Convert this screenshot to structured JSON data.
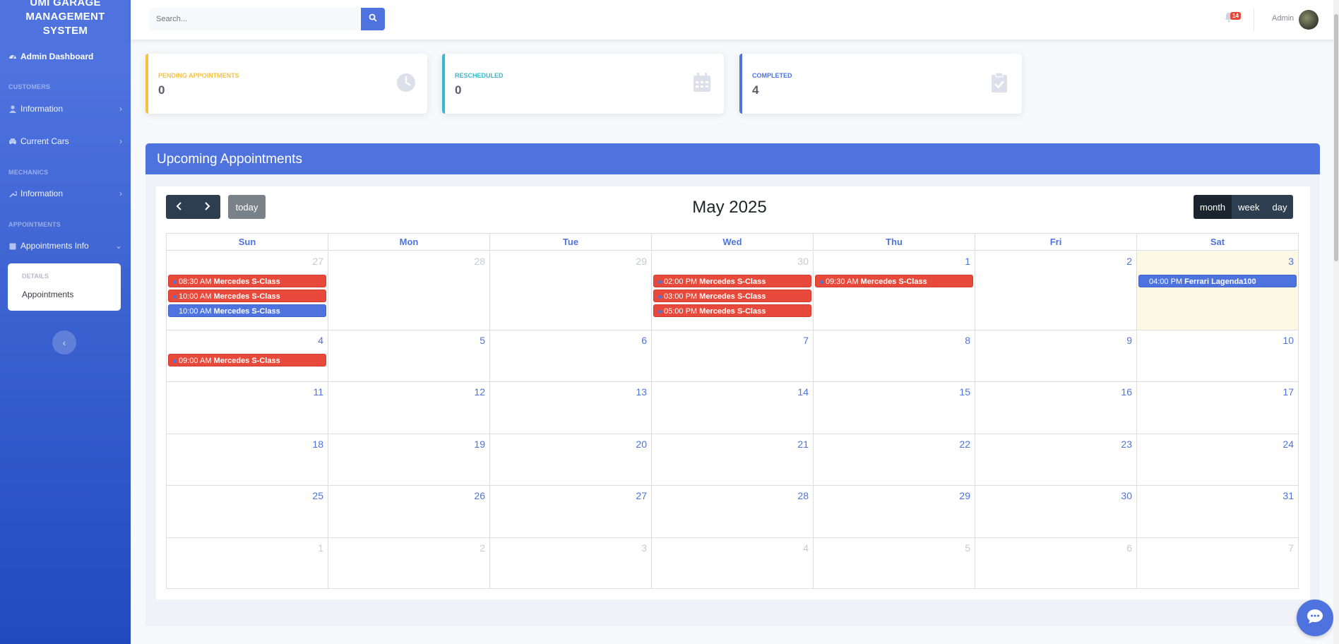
{
  "sidebar": {
    "brand": [
      "UMI GARAGE",
      "MANAGEMENT",
      "SYSTEM"
    ],
    "dashboard": "Admin Dashboard",
    "customers_heading": "CUSTOMERS",
    "customers_information": "Information",
    "current_cars": "Current Cars",
    "mechanics_heading": "MECHANICS",
    "mechanics_information": "Information",
    "appointments_heading": "APPOINTMENTS",
    "appointments_info": "Appointments Info",
    "submenu_heading": "DETAILS",
    "submenu_item": "Appointments"
  },
  "topbar": {
    "search_placeholder": "Search...",
    "alerts_count": "14",
    "user_name": "Admin"
  },
  "stats": [
    {
      "label": "PENDING APPOINTMENTS",
      "value": "0",
      "color": "#f6c23e"
    },
    {
      "label": "RESCHEDULED",
      "value": "0",
      "color": "#36b9cc"
    },
    {
      "label": "COMPLETED",
      "value": "4",
      "color": "#4e73df"
    }
  ],
  "upcoming": {
    "title": "Upcoming Appointments",
    "today_label": "today",
    "month_title": "May 2025",
    "views": [
      "month",
      "week",
      "day"
    ],
    "active_view": "month",
    "weekdays": [
      "Sun",
      "Mon",
      "Tue",
      "Wed",
      "Thu",
      "Fri",
      "Sat"
    ],
    "weeks": [
      [
        {
          "d": "27",
          "other": true,
          "events": [
            {
              "time": "08:30 AM",
              "title": "Mercedes S-Class",
              "color": "red"
            },
            {
              "time": "10:00 AM",
              "title": "Mercedes S-Class",
              "color": "red"
            },
            {
              "time": "10:00 AM",
              "title": "Mercedes S-Class",
              "color": "blue"
            }
          ]
        },
        {
          "d": "28",
          "other": true,
          "events": []
        },
        {
          "d": "29",
          "other": true,
          "events": []
        },
        {
          "d": "30",
          "other": true,
          "events": [
            {
              "time": "02:00 PM",
              "title": "Mercedes S-Class",
              "color": "red"
            },
            {
              "time": "03:00 PM",
              "title": "Mercedes S-Class",
              "color": "red"
            },
            {
              "time": "05:00 PM",
              "title": "Mercedes S-Class",
              "color": "red"
            }
          ]
        },
        {
          "d": "1",
          "events": [
            {
              "time": "09:30 AM",
              "title": "Mercedes S-Class",
              "color": "red"
            }
          ]
        },
        {
          "d": "2",
          "events": []
        },
        {
          "d": "3",
          "today": true,
          "events": [
            {
              "time": "04:00 PM",
              "title": "Ferrari Lagenda100",
              "color": "blue"
            }
          ]
        }
      ],
      [
        {
          "d": "4",
          "events": [
            {
              "time": "09:00 AM",
              "title": "Mercedes S-Class",
              "color": "red"
            }
          ]
        },
        {
          "d": "5",
          "events": []
        },
        {
          "d": "6",
          "events": []
        },
        {
          "d": "7",
          "events": []
        },
        {
          "d": "8",
          "events": []
        },
        {
          "d": "9",
          "events": []
        },
        {
          "d": "10",
          "events": []
        }
      ],
      [
        {
          "d": "11",
          "events": []
        },
        {
          "d": "12",
          "events": []
        },
        {
          "d": "13",
          "events": []
        },
        {
          "d": "14",
          "events": []
        },
        {
          "d": "15",
          "events": []
        },
        {
          "d": "16",
          "events": []
        },
        {
          "d": "17",
          "events": []
        }
      ],
      [
        {
          "d": "18",
          "events": []
        },
        {
          "d": "19",
          "events": []
        },
        {
          "d": "20",
          "events": []
        },
        {
          "d": "21",
          "events": []
        },
        {
          "d": "22",
          "events": []
        },
        {
          "d": "23",
          "events": []
        },
        {
          "d": "24",
          "events": []
        }
      ],
      [
        {
          "d": "25",
          "events": []
        },
        {
          "d": "26",
          "events": []
        },
        {
          "d": "27",
          "events": []
        },
        {
          "d": "28",
          "events": []
        },
        {
          "d": "29",
          "events": []
        },
        {
          "d": "30",
          "events": []
        },
        {
          "d": "31",
          "events": []
        }
      ],
      [
        {
          "d": "1",
          "other": true,
          "events": []
        },
        {
          "d": "2",
          "other": true,
          "events": []
        },
        {
          "d": "3",
          "other": true,
          "events": []
        },
        {
          "d": "4",
          "other": true,
          "events": []
        },
        {
          "d": "5",
          "other": true,
          "events": []
        },
        {
          "d": "6",
          "other": true,
          "events": []
        },
        {
          "d": "7",
          "other": true,
          "events": []
        }
      ]
    ]
  }
}
